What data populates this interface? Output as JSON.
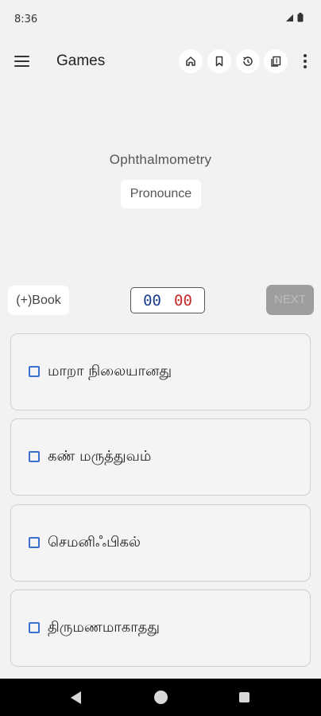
{
  "status_bar": {
    "time": "8:36"
  },
  "app_bar": {
    "title": "Games",
    "actions": [
      "home-icon",
      "bookmark-icon",
      "history-icon",
      "flashcards-icon"
    ]
  },
  "question": {
    "word": "Ophthalmometry",
    "pronounce_label": "Pronounce"
  },
  "controls": {
    "book_label": "(+)Book",
    "score_correct": "00",
    "score_wrong": "00",
    "next_label": "NEXT"
  },
  "options": [
    {
      "label": "மாறா நிலையானது"
    },
    {
      "label": "கண் மருத்துவம்"
    },
    {
      "label": "செமனிஃபிகல்"
    },
    {
      "label": "திருமணமாகாதது"
    }
  ],
  "colors": {
    "correct": "#1a3d8f",
    "wrong": "#c62828",
    "checkbox": "#3c6fd0"
  }
}
